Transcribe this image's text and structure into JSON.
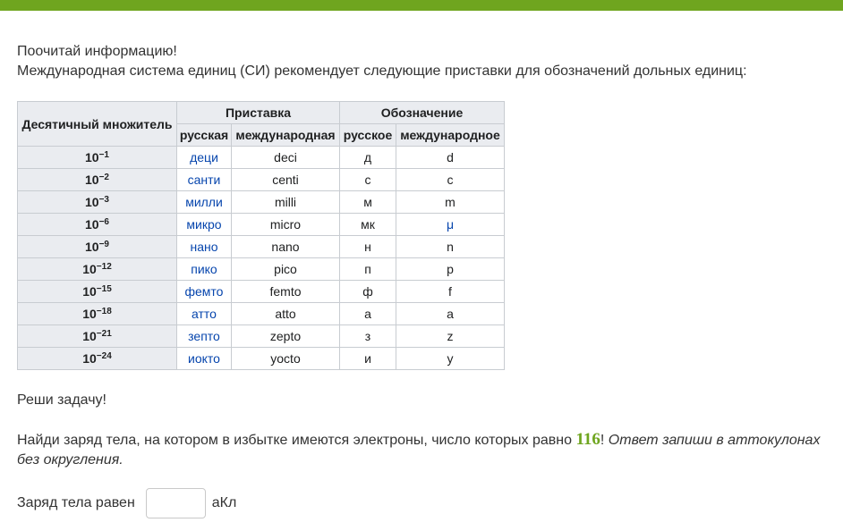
{
  "intro": {
    "line1": "Поочитай информацию!",
    "line2": "Международная система единиц (СИ) рекомендует следующие приставки для обозначений дольных единиц:"
  },
  "table": {
    "headers": {
      "multiplier": "Десятичный множитель",
      "prefix": "Приставка",
      "symbol": "Обозначение",
      "prefix_ru": "русская",
      "prefix_int": "международная",
      "symbol_ru": "русское",
      "symbol_int": "международное"
    },
    "rows": [
      {
        "base": "10",
        "exp": "−1",
        "prefix_ru": "деци",
        "prefix_int": "deci",
        "symbol_ru": "д",
        "symbol_int": "d"
      },
      {
        "base": "10",
        "exp": "−2",
        "prefix_ru": "санти",
        "prefix_int": "centi",
        "symbol_ru": "с",
        "symbol_int": "c"
      },
      {
        "base": "10",
        "exp": "−3",
        "prefix_ru": "милли",
        "prefix_int": "milli",
        "symbol_ru": "м",
        "symbol_int": "m"
      },
      {
        "base": "10",
        "exp": "−6",
        "prefix_ru": "микро",
        "prefix_int": "micro",
        "symbol_ru": "мк",
        "symbol_int": "μ"
      },
      {
        "base": "10",
        "exp": "−9",
        "prefix_ru": "нано",
        "prefix_int": "nano",
        "symbol_ru": "н",
        "symbol_int": "n"
      },
      {
        "base": "10",
        "exp": "−12",
        "prefix_ru": "пико",
        "prefix_int": "pico",
        "symbol_ru": "п",
        "symbol_int": "p"
      },
      {
        "base": "10",
        "exp": "−15",
        "prefix_ru": "фемто",
        "prefix_int": "femto",
        "symbol_ru": "ф",
        "symbol_int": "f"
      },
      {
        "base": "10",
        "exp": "−18",
        "prefix_ru": "атто",
        "prefix_int": "atto",
        "symbol_ru": "а",
        "symbol_int": "a"
      },
      {
        "base": "10",
        "exp": "−21",
        "prefix_ru": "зепто",
        "prefix_int": "zepto",
        "symbol_ru": "з",
        "symbol_int": "z"
      },
      {
        "base": "10",
        "exp": "−24",
        "prefix_ru": "иокто",
        "prefix_int": "yocto",
        "symbol_ru": "и",
        "symbol_int": "y"
      }
    ]
  },
  "task": {
    "heading": "Реши задачу!",
    "text_before": "Найди заряд тела, на котором в избытке имеются электроны, число которых равно ",
    "number": "116",
    "text_after": "! ",
    "italic_note": "Ответ запиши в аттокулонах без округления."
  },
  "answer": {
    "label": "Заряд тела равен",
    "value": "",
    "unit": "аКл"
  },
  "colors": {
    "accent": "#6fa51f",
    "link": "#0645ad",
    "header_bg": "#eaecf0",
    "border": "#c8ccd1"
  }
}
